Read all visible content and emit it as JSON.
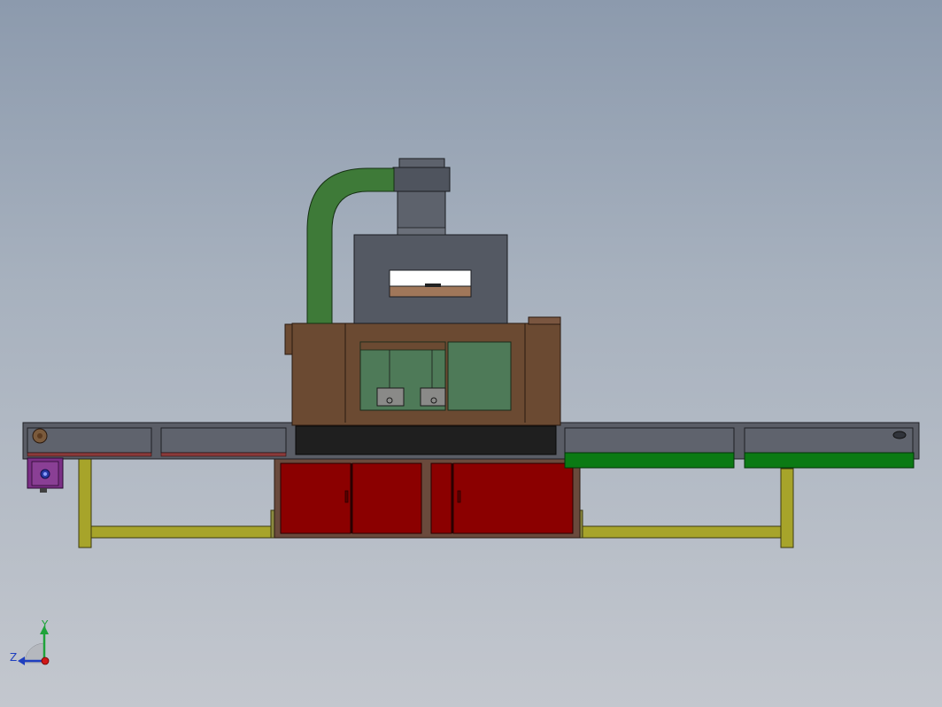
{
  "triad": {
    "y_label": "Y",
    "z_label": "Z"
  },
  "colors": {
    "cabinet_brown": "#6b4a32",
    "base_red": "#8b0000",
    "duct_green": "#3e7a38",
    "hood_gray": "#545963",
    "conveyor_gray": "#5a5d66",
    "belt_green": "#0b7a14",
    "frame_yellow": "#a7a42a",
    "motor_purple": "#7b2f86"
  }
}
